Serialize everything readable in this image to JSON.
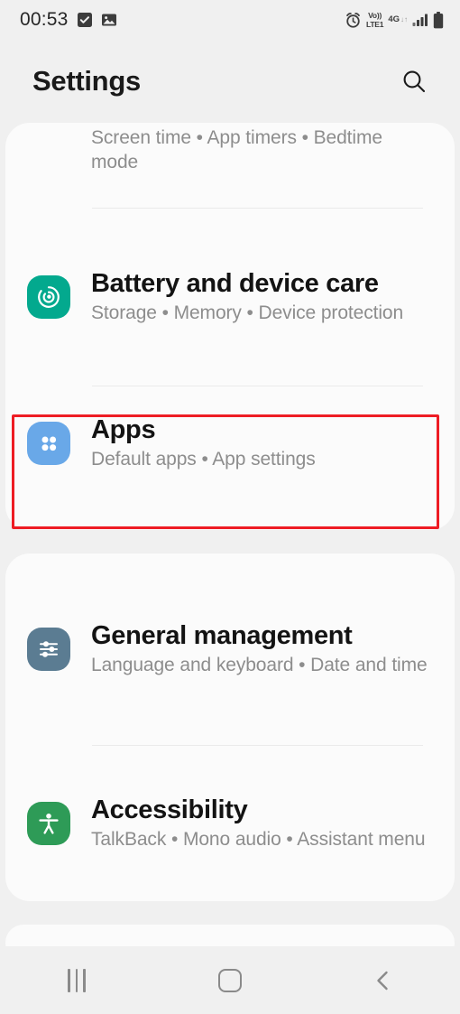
{
  "status_bar": {
    "clock": "00:53",
    "left_icons": [
      {
        "name": "checkbox-icon",
        "glyph": "check-square"
      },
      {
        "name": "image-icon",
        "glyph": "picture"
      }
    ],
    "right_icons": [
      {
        "name": "alarm-icon",
        "glyph": "alarm-clock"
      },
      {
        "name": "volte-icon",
        "line1": "Vo))",
        "line2": "LTE1"
      },
      {
        "name": "network-type-icon",
        "label": "4G",
        "arrows": "↓↑"
      },
      {
        "name": "signal-bars-icon",
        "bars": 4,
        "active": 3
      },
      {
        "name": "battery-icon",
        "level": 100
      }
    ]
  },
  "header": {
    "title": "Settings",
    "search_icon": "search-icon"
  },
  "cards": [
    {
      "id": "card-1",
      "rows": [
        {
          "id": "digital-wellbeing",
          "title": "",
          "subtitle": "Screen time • App timers • Bedtime mode",
          "icon": "digital-wellbeing-icon",
          "icon_color": "",
          "clipped": true,
          "divider_after": true
        },
        {
          "id": "battery-and-device-care",
          "title": "Battery and device care",
          "subtitle": "Storage • Memory • Device protection",
          "icon": "battery-care-icon",
          "icon_color": "#03A98E",
          "clipped": false,
          "divider_after": true
        },
        {
          "id": "apps",
          "title": "Apps",
          "subtitle": "Default apps • App settings",
          "icon": "apps-grid-icon",
          "icon_color": "#69A8E8",
          "clipped": false,
          "divider_after": false,
          "highlighted": true
        }
      ]
    },
    {
      "id": "card-2",
      "rows": [
        {
          "id": "general-management",
          "title": "General management",
          "subtitle": "Language and keyboard • Date and time",
          "icon": "sliders-icon",
          "icon_color": "#5B7C92",
          "clipped": false,
          "divider_after": true
        },
        {
          "id": "accessibility",
          "title": "Accessibility",
          "subtitle": "TalkBack • Mono audio • Assistant menu",
          "icon": "accessibility-person-icon",
          "icon_color": "#2E9B57",
          "clipped": false,
          "divider_after": false
        }
      ]
    }
  ],
  "highlight": {
    "target": "apps",
    "color": "#EE1C24"
  },
  "nav_bar": {
    "recents_label": "Recents",
    "home_label": "Home",
    "back_label": "Back"
  }
}
